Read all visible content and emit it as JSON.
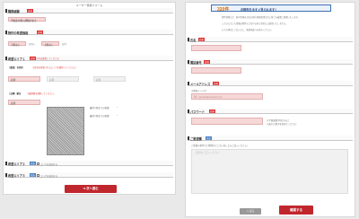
{
  "left": {
    "title": "ユーザー登録フォーム",
    "sections": {
      "occupation": {
        "label": "職務経験",
        "req": "必須"
      },
      "residence": {
        "label": "物件の希望価格",
        "req": "必須"
      },
      "photo1": {
        "label": "希望エリア１",
        "req": "必須",
        "note": "※申込選択してください"
      },
      "photo2": {
        "label": "希望エリア２",
        "opt": "任意"
      },
      "photo3": {
        "label": "希望エリア３",
        "opt": "任意"
      }
    },
    "occupation_select": "不動産の購入経験がある",
    "price_min": "下限なし",
    "price_min_unit": "万円〜",
    "price_max": "上限なし",
    "price_max_unit": "万円",
    "area_label": "［都道］市区町",
    "area_note": "※居住を希望されるエリアを選択してください。",
    "area_select1": "必須",
    "area_select2": "必須",
    "area_select3": "必須",
    "station_label": "［沿線］駅名",
    "station_note": "※最寄駅を選択してください。",
    "station_select": "必須",
    "photo_side1": "最寄り駅までの距離",
    "photo_side2": "最寄り駅までの距離",
    "check2": "エリアを追加する",
    "check3": "エリアを追加する",
    "next_button": "次へ進む"
  },
  "right": {
    "banner_count": "320件",
    "banner_msg": "の物件を今すぐ見られます！",
    "intro1": "物件情報など、個人情報は当社の個人情報保護方針に基づき厳重に管理いたします。",
    "intro2": "入力いただいた情報は物件のご紹介以外の目的には使用いたしません。",
    "intro3": "以下の項目にご記入の上、確認画面へお進みください。",
    "name": {
      "label": "氏名",
      "req": "必須"
    },
    "tel": {
      "label": "電話番号",
      "req": "必須"
    },
    "email": {
      "label": "メールアドレス",
      "req": "必須",
      "hint": "※携帯メール可",
      "placeholder": "例）sample@example.com"
    },
    "password": {
      "label": "パスワード",
      "req": "必須",
      "hint1": "※半角英数字6文字以上",
      "hint2": "※英字と数字を含めてください"
    },
    "remarks": {
      "label": "ご要望欄",
      "opt": "任意",
      "hint": "ご希望の条件やご質問などございましたらご記入ください。",
      "placeholder": "ご要望をご記入ください"
    },
    "back_button": "＜ 戻る",
    "confirm_button": "確認する"
  }
}
